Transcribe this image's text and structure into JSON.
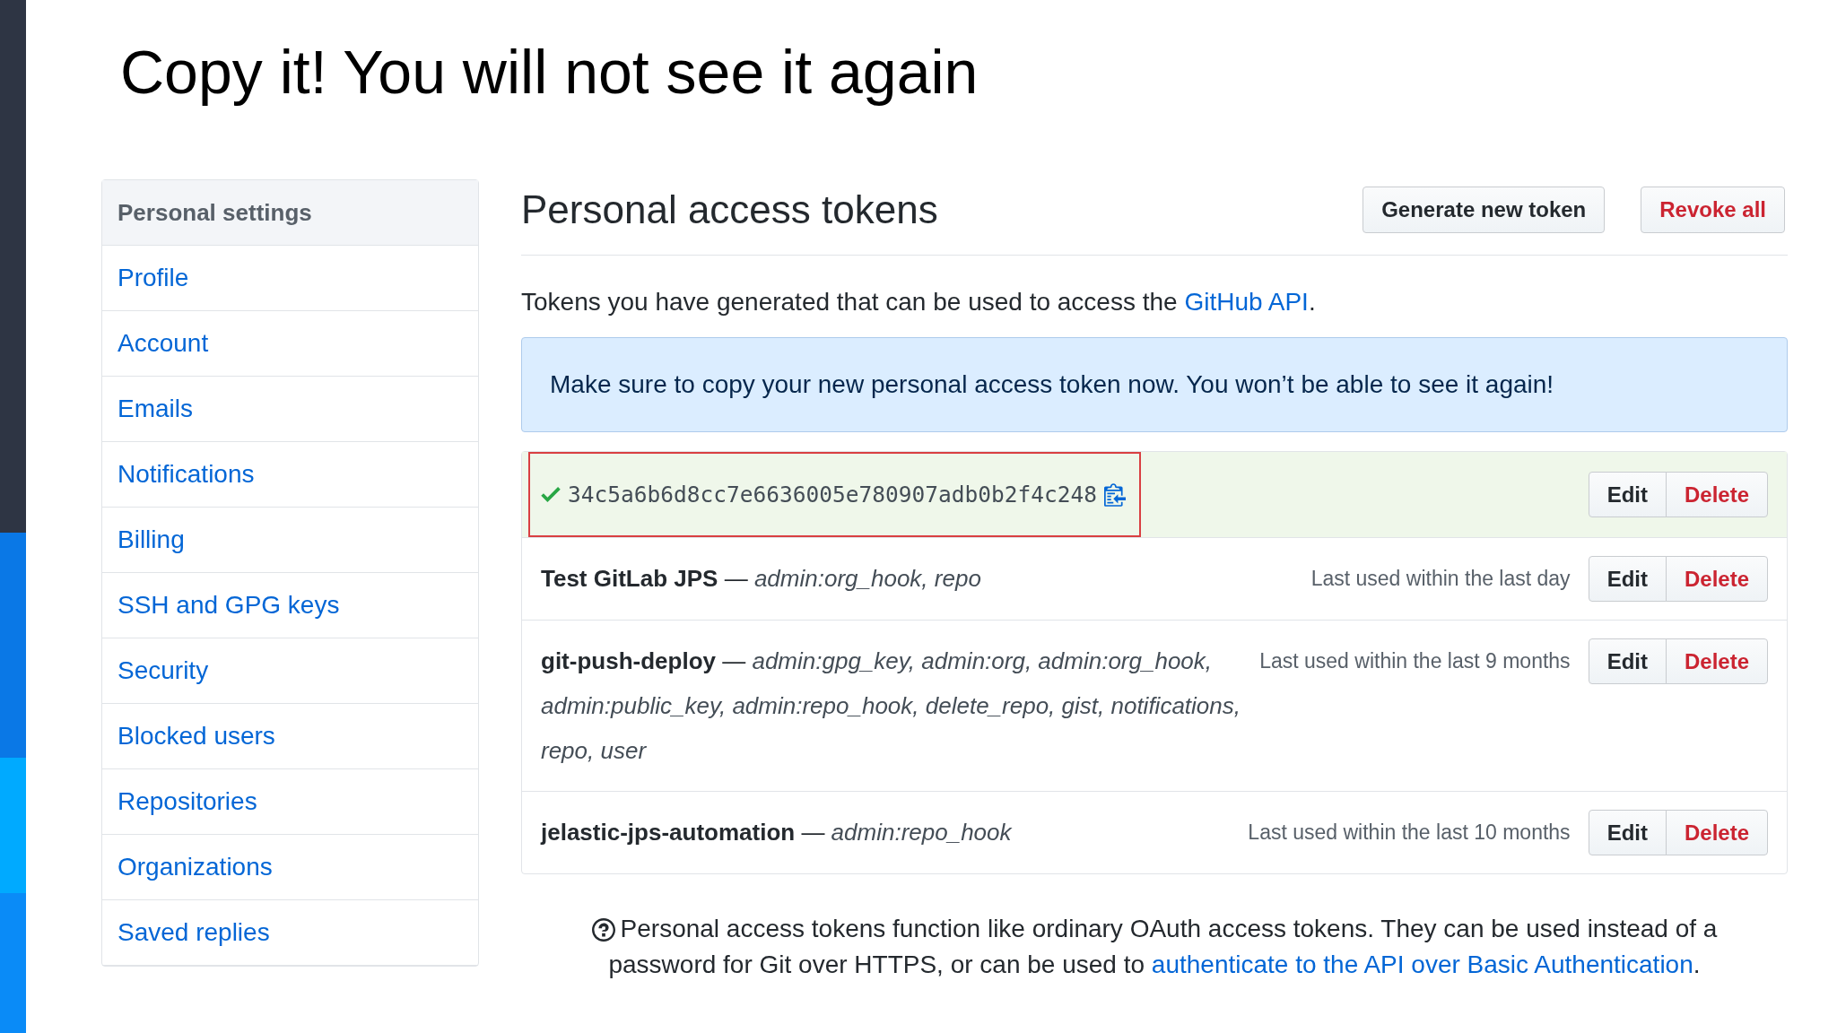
{
  "slide": {
    "title": "Copy it! You will not see it again"
  },
  "sidebar": {
    "heading": "Personal settings",
    "items": [
      {
        "label": "Profile",
        "selected": false
      },
      {
        "label": "Account",
        "selected": false
      },
      {
        "label": "Emails",
        "selected": false
      },
      {
        "label": "Notifications",
        "selected": false
      },
      {
        "label": "Billing",
        "selected": false
      },
      {
        "label": "SSH and GPG keys",
        "selected": false
      },
      {
        "label": "Security",
        "selected": false
      },
      {
        "label": "Blocked users",
        "selected": false
      },
      {
        "label": "Repositories",
        "selected": false
      },
      {
        "label": "Organizations",
        "selected": false
      },
      {
        "label": "Saved replies",
        "selected": false
      }
    ]
  },
  "main": {
    "heading": "Personal access tokens",
    "buttons": [
      {
        "label": "Generate new token",
        "kind": "default"
      },
      {
        "label": "Revoke all",
        "kind": "danger"
      }
    ],
    "description": {
      "text_before": "Tokens you have generated that can be used to access the ",
      "link": "GitHub API",
      "text_after": "."
    },
    "flash": {
      "message": "Make sure to copy your new personal access token now. You won’t be able to see it again!"
    },
    "tokens": [
      {
        "kind": "new",
        "value": "34c5a6b6d8cc7e6636005e780907adb0b2f4c248",
        "highlighted": true,
        "edit": "Edit",
        "delete": "Delete"
      },
      {
        "kind": "existing",
        "description": "**Test GitLab JPS** — *admin:org_hook, repo*",
        "last_used": "Last used within the last day",
        "highlighted": false,
        "edit": "Edit",
        "delete": "Delete"
      },
      {
        "kind": "existing",
        "description": "**git-push-deploy** — *admin:gpg_key, admin:org, admin:org_hook, admin:public_key, admin:repo_hook, delete_repo, gist, notifications, repo, user*",
        "last_used": "Last used within the last 9 months",
        "highlighted": false,
        "edit": "Edit",
        "delete": "Delete"
      },
      {
        "kind": "existing",
        "description": "**jelastic-jps-automation** — *admin:repo_hook*",
        "last_used": "Last used within the last 10 months",
        "highlighted": false,
        "edit": "Edit",
        "delete": "Delete"
      }
    ],
    "footer": {
      "text_before": "Personal access tokens function like ordinary OAuth access tokens. They can be used instead of a password for Git over HTTPS, or can be used to ",
      "link": "authenticate to the API over Basic Authentication",
      "text_after": "."
    }
  }
}
